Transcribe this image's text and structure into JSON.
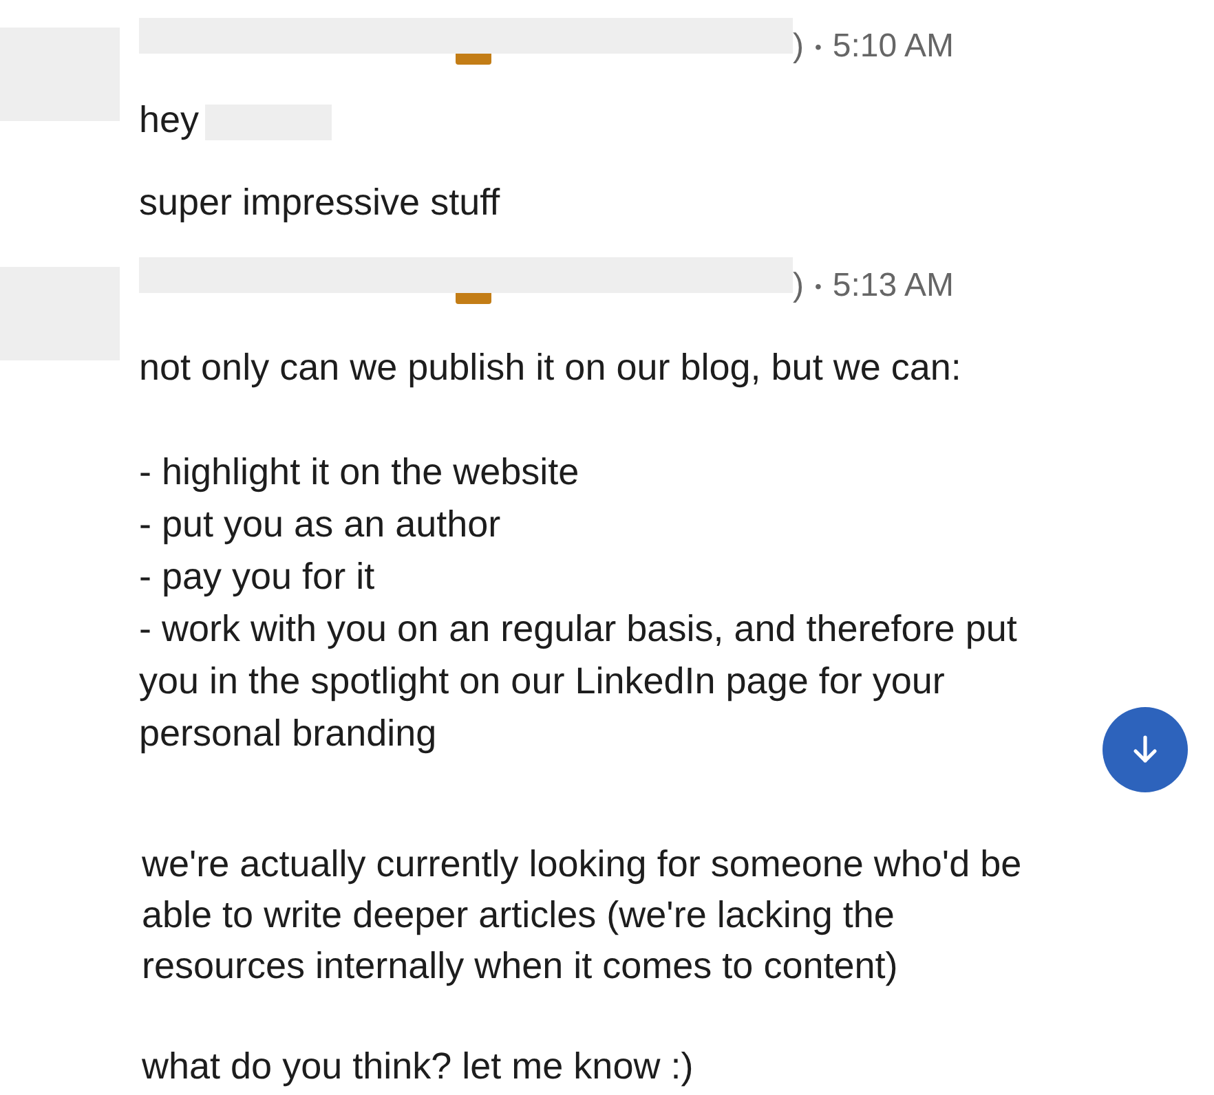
{
  "messages": [
    {
      "suffix": ")",
      "separator": "•",
      "time": "5:10 AM",
      "blocks": [
        [
          "hey"
        ],
        [
          "super impressive stuff"
        ]
      ],
      "redacted_greeting": true
    },
    {
      "suffix": ")",
      "separator": "•",
      "time": "5:13 AM",
      "blocks": [
        [
          "not only can we publish it on our blog, but we can:"
        ],
        [
          "- highlight it on the website",
          "- put you as an author",
          "- pay you for it",
          "- work with you on an regular basis, and therefore put you in the spotlight on our LinkedIn page for your personal branding"
        ]
      ],
      "redacted_greeting": false
    }
  ],
  "continued": [
    [
      "we're actually currently looking for someone who'd be able to write deeper articles (we're lacking the resources internally when it comes to content)"
    ],
    [
      "what do you think? let me know :)"
    ]
  ]
}
